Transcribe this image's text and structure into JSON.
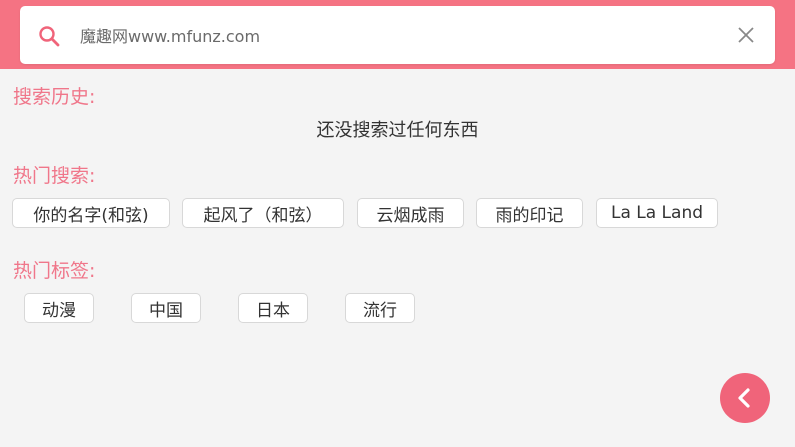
{
  "search": {
    "placeholder": "魔趣网www.mfunz.com",
    "icon": "search-icon",
    "clear_icon": "close-icon"
  },
  "history": {
    "title": "搜索历史:",
    "empty_text": "还没搜索过任何东西"
  },
  "hot_search": {
    "title": "热门搜索:",
    "items": [
      "你的名字(和弦)",
      "起风了（和弦）",
      "云烟成雨",
      "雨的印记",
      "La La Land"
    ]
  },
  "hot_tags": {
    "title": "热门标签:",
    "items": [
      "动漫",
      "中国",
      "日本",
      "流行"
    ]
  },
  "fab": {
    "icon": "chevron-left-icon"
  },
  "colors": {
    "accent": "#f57383",
    "title_text": "#f0768a",
    "fab": "#f0647a"
  }
}
